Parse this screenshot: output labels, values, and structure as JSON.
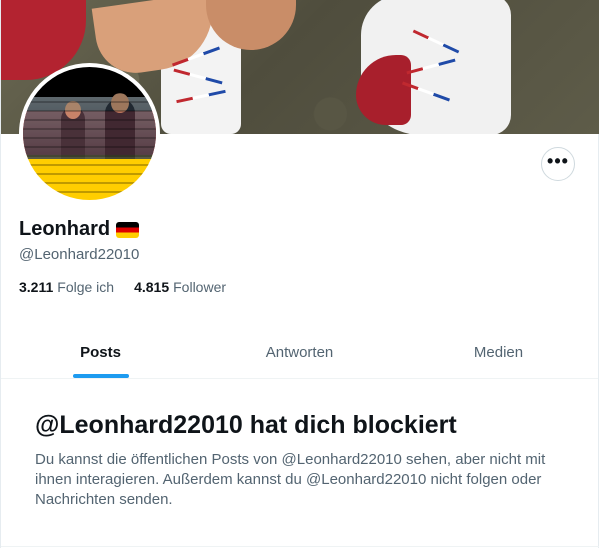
{
  "profile": {
    "display_name": "Leonhard",
    "flag_emoji": "🇩🇪",
    "handle": "@Leonhard22010",
    "following_count": "3.211",
    "following_label": "Folge ich",
    "followers_count": "4.815",
    "followers_label": "Follower"
  },
  "more_button": {
    "label": "•••"
  },
  "tabs": [
    {
      "label": "Posts",
      "active": true
    },
    {
      "label": "Antworten",
      "active": false
    },
    {
      "label": "Medien",
      "active": false
    }
  ],
  "blocked": {
    "title": "@Leonhard22010 hat dich blockiert",
    "text": "Du kannst die öffentlichen Posts von @Leonhard22010 sehen, aber nicht mit ihnen interagieren. Außerdem kannst du @Leonhard22010 nicht folgen oder Nachrichten senden."
  },
  "colors": {
    "accent": "#1d9bf0",
    "text_primary": "#0f1419",
    "text_secondary": "#536471"
  }
}
